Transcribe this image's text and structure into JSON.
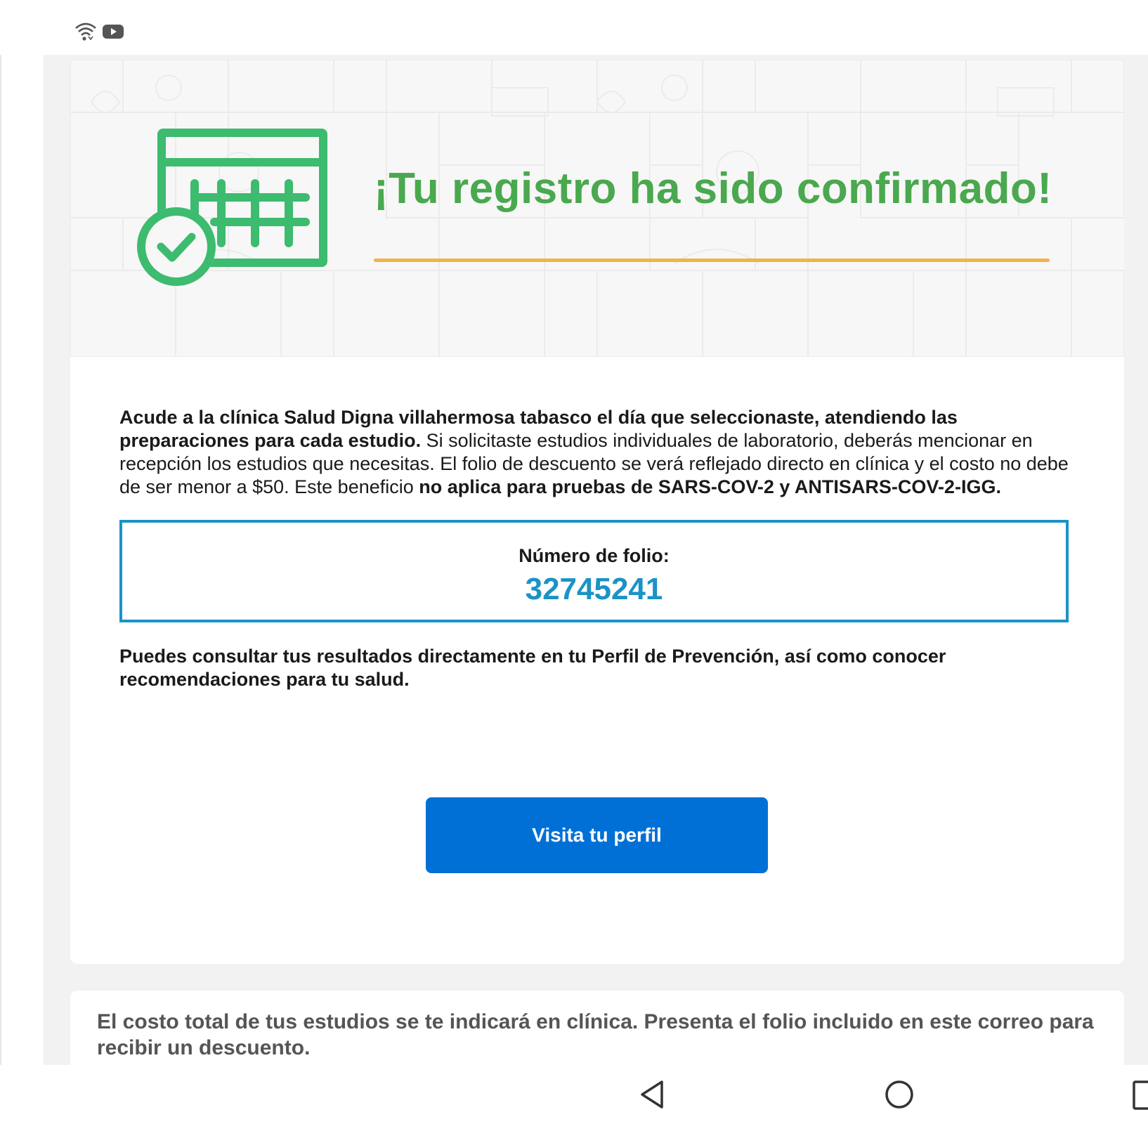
{
  "status_bar": {
    "icons": [
      "wifi-icon",
      "youtube-icon"
    ]
  },
  "hero": {
    "title": "¡Tu registro ha sido confirmado!",
    "icon": "calendar-check-icon",
    "colors": {
      "title": "#4aa84e",
      "underline": "#f1b24a",
      "icon": "#3dbb6f"
    }
  },
  "intro": {
    "bold_part": "Acude a la clínica Salud Digna villahermosa tabasco el día que seleccionaste, atendiendo las preparaciones para cada estudio.",
    "normal_part": " Si solicitaste estudios individuales de laboratorio, deberás mencionar en recepción los estudios que necesitas. El folio de descuento se verá reflejado directo en clínica y el costo no debe de ser menor a $50. Este beneficio ",
    "bold_end": "no aplica para pruebas de SARS-COV-2 y ANTISARS-COV-2-IGG."
  },
  "folio": {
    "label": "Número de folio:",
    "number": "32745241",
    "accent": "#1a93c6"
  },
  "results_text": "Puedes consultar tus resultados directamente en tu Perfil de Prevención, así como conocer recomendaciones para tu salud.",
  "profile_button": {
    "label": "Visita tu perfil",
    "color": "#0070d6"
  },
  "cost_note": "El costo total de tus estudios se te indicará en clínica. Presenta el folio incluido en este correo para recibir un descuento.",
  "nav_bar": {
    "icons": [
      "back-icon",
      "home-icon",
      "recents-icon"
    ]
  }
}
